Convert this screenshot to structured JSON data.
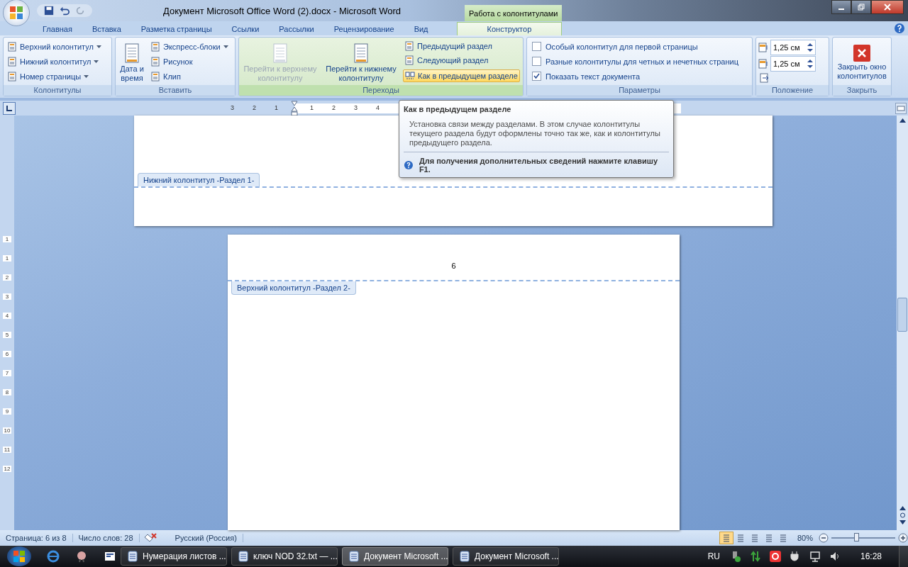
{
  "window": {
    "title": "Документ Microsoft Office Word (2).docx - Microsoft Word",
    "context_title": "Работа с колонтитулами"
  },
  "tabs": [
    {
      "label": "Главная",
      "selected": false,
      "kind": "normal"
    },
    {
      "label": "Вставка",
      "selected": false,
      "kind": "normal"
    },
    {
      "label": "Разметка страницы",
      "selected": false,
      "kind": "normal"
    },
    {
      "label": "Ссылки",
      "selected": false,
      "kind": "normal"
    },
    {
      "label": "Рассылки",
      "selected": false,
      "kind": "normal"
    },
    {
      "label": "Рецензирование",
      "selected": false,
      "kind": "normal"
    },
    {
      "label": "Вид",
      "selected": false,
      "kind": "normal"
    },
    {
      "label": "Конструктор",
      "selected": true,
      "kind": "contextual"
    }
  ],
  "ribbon": {
    "groups": [
      {
        "label": "Колонтитулы",
        "columns": [
          {
            "items": [
              {
                "kind": "small",
                "label": "Верхний колонтитул",
                "dropdown": true
              },
              {
                "kind": "small",
                "label": "Нижний колонтитул",
                "dropdown": true
              },
              {
                "kind": "small",
                "label": "Номер страницы",
                "dropdown": true
              }
            ]
          }
        ]
      },
      {
        "label": "Вставить",
        "columns": [
          {
            "items": [
              {
                "kind": "large",
                "label": "Дата и время",
                "disabled": false
              }
            ]
          },
          {
            "items": [
              {
                "kind": "small",
                "label": "Экспресс-блоки",
                "dropdown": true
              },
              {
                "kind": "small",
                "label": "Рисунок",
                "dropdown": false
              },
              {
                "kind": "small",
                "label": "Клип",
                "dropdown": false
              }
            ]
          }
        ]
      },
      {
        "label": "Переходы",
        "columns": [
          {
            "items": [
              {
                "kind": "large",
                "label": "Перейти к верхнему колонтитулу",
                "disabled": true
              }
            ]
          },
          {
            "items": [
              {
                "kind": "large",
                "label": "Перейти к нижнему колонтитулу",
                "disabled": false
              }
            ]
          },
          {
            "items": [
              {
                "kind": "small",
                "label": "Предыдущий раздел",
                "dropdown": false
              },
              {
                "kind": "small",
                "label": "Следующий раздел",
                "dropdown": false
              },
              {
                "kind": "toggle",
                "label": "Как в предыдущем разделе",
                "on": true
              }
            ]
          }
        ]
      },
      {
        "label": "Параметры",
        "columns": [
          {
            "items": [
              {
                "kind": "checkbox",
                "label": "Особый колонтитул для первой страницы",
                "checked": false
              },
              {
                "kind": "checkbox",
                "label": "Разные колонтитулы для четных и нечетных страниц",
                "checked": false
              },
              {
                "kind": "checkbox",
                "label": "Показать текст документа",
                "checked": true
              }
            ]
          }
        ]
      },
      {
        "label": "Положение",
        "columns": [
          {
            "items": [
              {
                "kind": "spin",
                "value": "1,25 см"
              },
              {
                "kind": "spin",
                "value": "1,25 см"
              },
              {
                "kind": "icon"
              }
            ]
          }
        ]
      },
      {
        "label": "Закрыть",
        "columns": [
          {
            "items": [
              {
                "kind": "close",
                "label": "Закрыть окно колонтитулов"
              }
            ]
          }
        ]
      }
    ]
  },
  "ruler": {
    "labels": [
      "3",
      "2",
      "1",
      "1",
      "2",
      "3",
      "4"
    ]
  },
  "vruler": {
    "labels": [
      "1",
      "1",
      "2",
      "3",
      "4",
      "5",
      "6",
      "7",
      "8",
      "9",
      "10",
      "11",
      "12"
    ]
  },
  "tooltip": {
    "title": "Как в предыдущем разделе",
    "body": "Установка связи между разделами. В этом случае колонтитулы текущего раздела будут оформлены точно так же, как и колонтитулы предыдущего раздела.",
    "help": "Для получения дополнительных сведений нажмите клавишу F1."
  },
  "pages": {
    "footer_label": "Нижний колонтитул -Раздел 1-",
    "page_number": "6",
    "header_label": "Верхний колонтитул -Раздел 2-"
  },
  "status_bar": {
    "items": [
      "Страница: 6 из 8",
      "Число слов: 28"
    ],
    "language": "Русский (Россия)",
    "views": [
      {
        "selected": true
      },
      {
        "selected": false
      },
      {
        "selected": false
      },
      {
        "selected": false
      },
      {
        "selected": false
      }
    ],
    "zoom": "80%",
    "zoom_slider": {
      "level": 0.4
    }
  },
  "taskbar": {
    "tasks": [
      {
        "label": "Нумерация листов ...",
        "selected": false
      },
      {
        "label": "ключ NOD 32.txt — ...",
        "selected": false
      },
      {
        "label": "Документ Microsoft ...",
        "selected": true
      },
      {
        "label": "Документ Microsoft ...",
        "selected": false
      }
    ],
    "lang": "RU",
    "clock": "16:28"
  }
}
